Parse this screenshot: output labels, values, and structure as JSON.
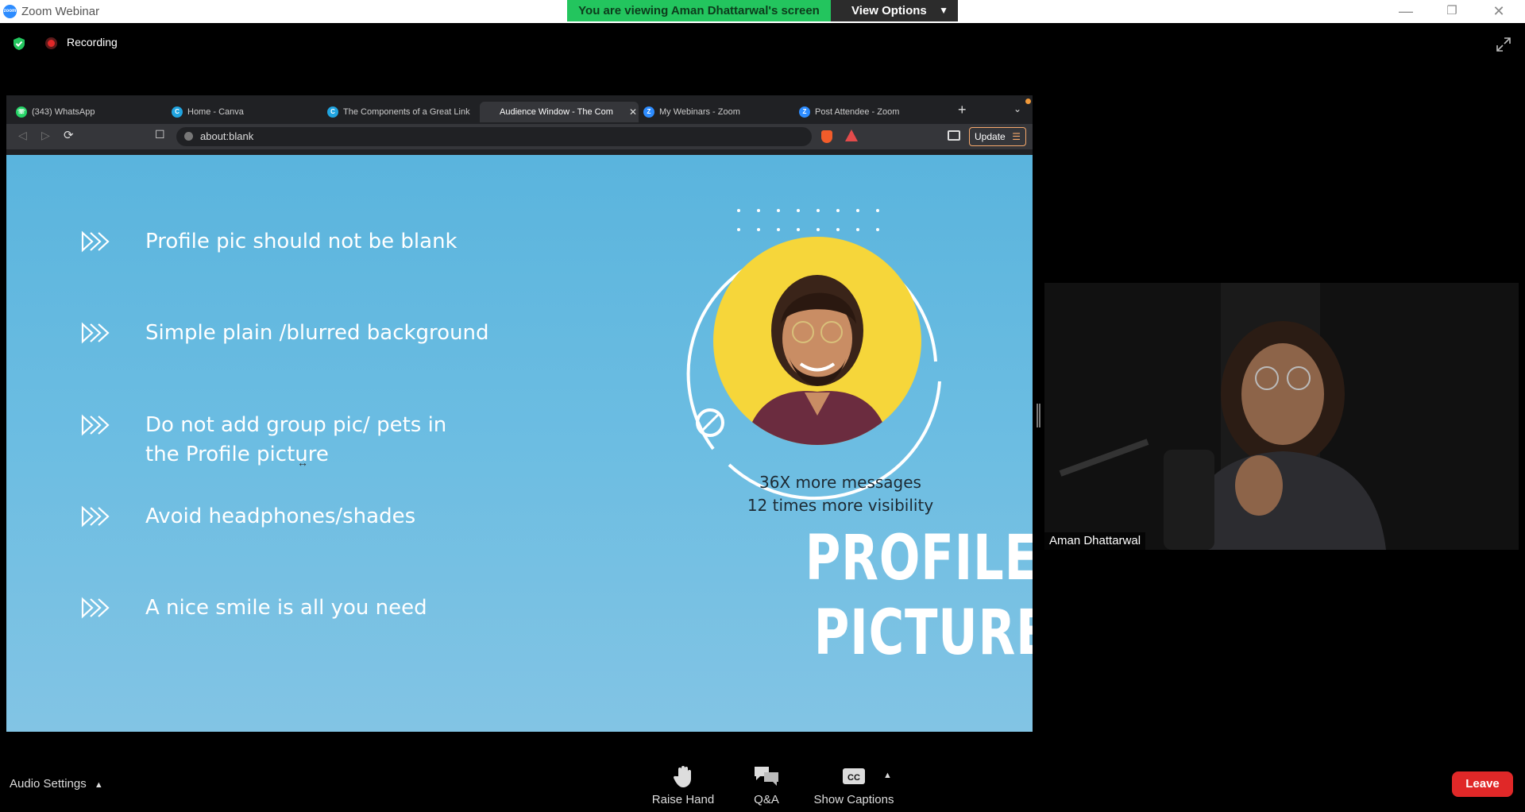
{
  "window": {
    "title": "Zoom Webinar",
    "viewing_banner": "You are viewing Aman Dhattarwal's screen",
    "view_options": "View Options"
  },
  "meeting": {
    "recording_label": "Recording"
  },
  "browser": {
    "tabs": [
      {
        "label": "(343) WhatsApp",
        "icon": "whatsapp-icon",
        "color": "#25d366"
      },
      {
        "label": "Home - Canva",
        "icon": "canva-icon",
        "color": "#20a4e0"
      },
      {
        "label": "The Components of a Great Link",
        "icon": "canva-icon",
        "color": "#20a4e0"
      },
      {
        "label": "Audience Window - The Com",
        "icon": "audience-icon",
        "color": "#35363a"
      },
      {
        "label": "My Webinars - Zoom",
        "icon": "zoom-icon",
        "color": "#2d8cff"
      },
      {
        "label": "Post Attendee - Zoom",
        "icon": "zoom-icon",
        "color": "#2d8cff"
      }
    ],
    "url": "about:blank",
    "update_label": "Update"
  },
  "slide": {
    "bullets": [
      "Profile pic should not be blank",
      "Simple plain /blurred background",
      "Do not add group pic/ pets in the Profile picture",
      "Avoid headphones/shades",
      "A nice smile is all you need"
    ],
    "stat_1": "36X more messages",
    "stat_2": "12 times more visibility",
    "title_line_1": "PROFILE",
    "title_line_2": "PICTURE"
  },
  "participant": {
    "name": "Aman Dhattarwal"
  },
  "controls": {
    "audio_settings": "Audio Settings",
    "raise_hand": "Raise Hand",
    "qa": "Q&A",
    "show_captions": "Show Captions",
    "leave": "Leave"
  }
}
